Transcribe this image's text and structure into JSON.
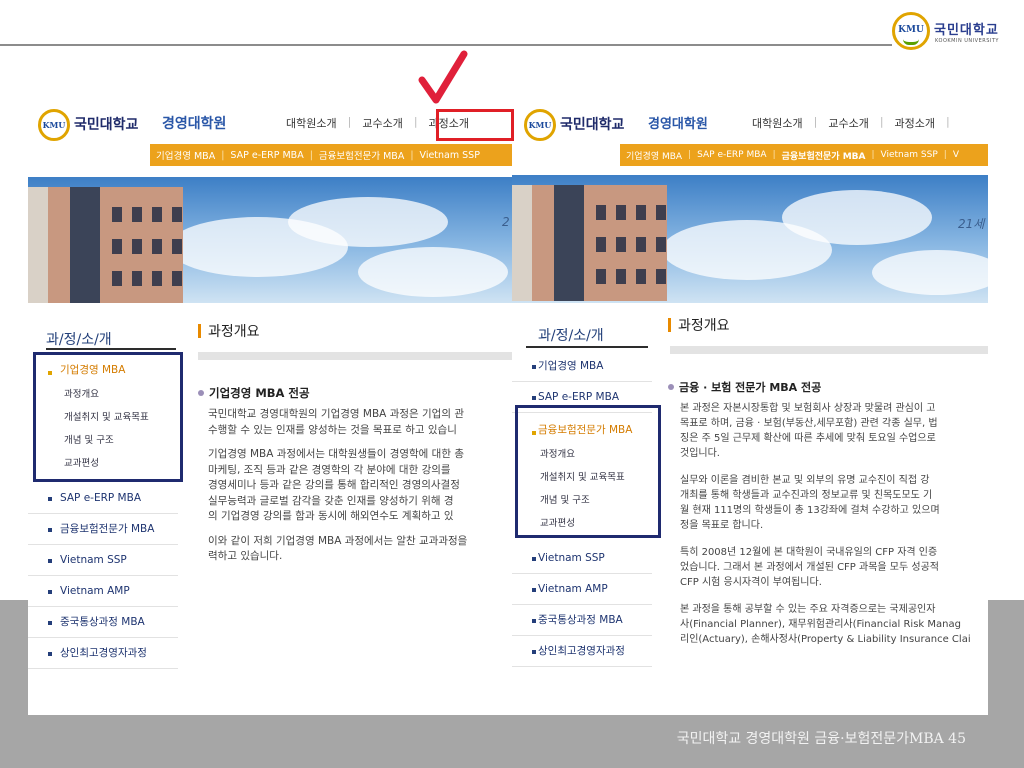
{
  "slide": {
    "logo_seal": "KMU",
    "logo_name": "국민대학교",
    "logo_sub": "KOOKMIN UNIVERSITY",
    "footer": "국민대학교 경영대학원 금융·보험전문가MBA 45"
  },
  "left": {
    "uname": "국민대학교",
    "gname": "경영대학원",
    "gnb": [
      "대학원소개",
      "교수소개",
      "과정소개"
    ],
    "subnav": [
      "기업경영 MBA",
      "SAP e-ERP MBA",
      "금융보험전문가 MBA",
      "Vietnam SSP"
    ],
    "banner_text": "2",
    "side_title": "과/정/소/개",
    "menu": {
      "active": "기업경영 MBA",
      "subs": [
        "과정개요",
        "개설취지 및 교육목표",
        "개념 및 구조",
        "교과편성"
      ],
      "items": [
        "SAP e-ERP MBA",
        "금융보험전문가 MBA",
        "Vietnam SSP",
        "Vietnam AMP",
        "중국통상과정 MBA",
        "상인최고경영자과정"
      ]
    },
    "page_title": "과정개요",
    "content_head": "기업경영 MBA 전공",
    "paragraphs": [
      [
        "국민대학교 경영대학원의 기업경영 MBA 과정은 기업의 관",
        "수행할 수 있는 인재를 양성하는 것을 목표로 하고 있습니"
      ],
      [
        "기업경영 MBA 과정에서는 대학원생들이 경영학에 대한 총",
        "마케팅, 조직 등과 같은 경영학의 각 분야에 대한 강의를 ",
        "경영세미나 등과 같은 강의를 통해 합리적인 경영의사결정",
        "실무능력과 글로벌 감각을 갖춘 인재를 양성하기 위해 경",
        "의 기업경영 강의를 함과 동시에 해외연수도 계획하고 있"
      ],
      [
        "이와 같이 저희 기업경영 MBA 과정에서는 알찬 교과과정을",
        "력하고 있습니다."
      ]
    ]
  },
  "right": {
    "uname": "국민대학교",
    "gname": "경영대학원",
    "gnb": [
      "대학원소개",
      "교수소개",
      "과정소개"
    ],
    "subnav": [
      "기업경영 MBA",
      "SAP e-ERP MBA",
      "금융보험전문가 MBA",
      "Vietnam SSP",
      "V"
    ],
    "banner_text": "21세",
    "side_title": "과/정/소/개",
    "menu": {
      "top": [
        "기업경영 MBA",
        "SAP e-ERP MBA"
      ],
      "active": "금융보험전문가 MBA",
      "subs": [
        "과정개요",
        "개설취지 및 교육목표",
        "개념 및 구조",
        "교과편성"
      ],
      "items": [
        "Vietnam SSP",
        "Vietnam AMP",
        "중국통상과정 MBA",
        "상인최고경영자과정"
      ]
    },
    "page_title": "과정개요",
    "content_head": "금융 · 보험 전문가 MBA 전공",
    "paragraphs": [
      [
        "본 과정은 자본시장통합 및 보험회사 상장과 맞물려 관심이 고",
        "목표로 하며, 금융 · 보험(부동산,세무포함) 관련 각종 실무, 법",
        "징은 주 5일 근무제 확산에 따른 추세에 맞춰 토요일 수업으로",
        "것입니다."
      ],
      [
        "실무와 이론을 겸비한 본교 및 외부의 유명 교수진이 직접 강",
        "개최를 통해 학생들과 교수진과의 정보교류 및 친목도모도 기",
        "월 현재 111명의 학생들이 총 13강좌에 걸쳐 수강하고 있으며",
        "정을 목표로 합니다."
      ],
      [
        "특히 2008년 12월에 본 대학원이 국내유일의 CFP 자격 인증",
        "었습니다. 그래서 본 과정에서 개설된 CFP 과목을 모두 성공적",
        "CFP 시험 응시자격이 부여됩니다."
      ],
      [
        "본 과정을 통해 공부할 수 있는 주요 자격증으로는 국제공인자",
        "사(Financial Planner), 재무위험관리사(Financial Risk Manag",
        "리인(Actuary), 손해사정사(Property & Liability Insurance Clai"
      ]
    ]
  }
}
